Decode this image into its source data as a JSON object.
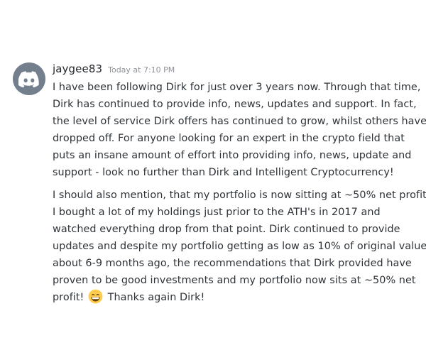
{
  "message": {
    "avatar_icon": "discord-logo-icon",
    "username": "jaygee83",
    "timestamp": "Today at 7:10 PM",
    "paragraph_1": [
      "I have been following Dirk for just over 3  years now. Through that time,",
      "Dirk has continued to provide info, news, updates and support. In fact,",
      "the level of service Dirk offers has continued to grow, whilst others have",
      "dropped off. For anyone looking for an expert in the crypto field that",
      "puts an insane amount of effort into providing info, news, update and",
      "support - look no further than Dirk and Intelligent Cryptocurrency!"
    ],
    "paragraph_2": [
      "I should also mention, that my portfolio is now sitting at ~50% net profit.",
      "I bought a lot of my holdings just prior to the ATH's in 2017 and",
      "watched everything drop from that point. Dirk continued to provide",
      "updates and despite my portfolio getting as low as 10% of original value",
      "about 6-9 months ago, the recommendations that Dirk provided have",
      "proven to be good investments and my portfolio now sits at ~50% net"
    ],
    "paragraph_2_last_before_emoji": "profit!",
    "emoji_icon": "grinning-smiling-eyes-emoji-icon",
    "paragraph_2_last_after_emoji": "Thanks again Dirk!"
  },
  "colors": {
    "avatar_bg": "#747f8d",
    "username": "#23262a",
    "timestamp": "#8e9297",
    "text": "#2e3338"
  }
}
